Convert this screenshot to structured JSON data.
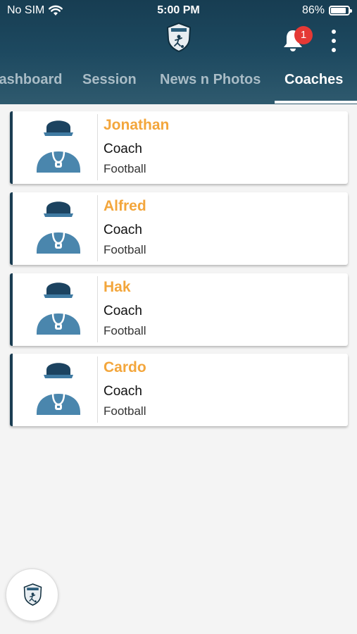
{
  "status_bar": {
    "carrier": "No SIM",
    "time": "5:00 PM",
    "battery": "86%",
    "battery_level": 0.86
  },
  "header": {
    "notification_count": "1"
  },
  "tabs": [
    {
      "label": "Dashboard"
    },
    {
      "label": "Session"
    },
    {
      "label": "News n Photos"
    },
    {
      "label": "Coaches"
    }
  ],
  "active_tab": "Coaches",
  "coaches": [
    {
      "name": "Jonathan",
      "role": "Coach",
      "sport": "Football"
    },
    {
      "name": "Alfred",
      "role": "Coach",
      "sport": "Football"
    },
    {
      "name": "Hak",
      "role": "Coach",
      "sport": "Football"
    },
    {
      "name": "Cardo",
      "role": "Coach",
      "sport": "Football"
    }
  ],
  "colors": {
    "header": "#1d4960",
    "accent_name": "#f3a63c",
    "avatar_blue": "#4a86ad",
    "badge": "#e53935"
  }
}
